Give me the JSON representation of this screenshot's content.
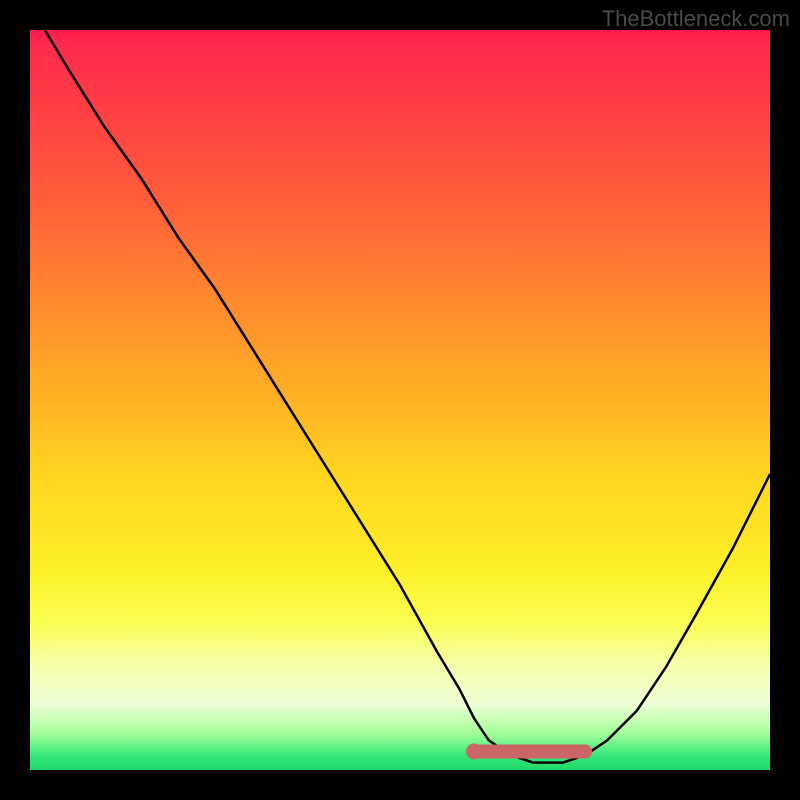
{
  "watermark": "TheBottleneck.com",
  "colors": {
    "background": "#000000",
    "curve": "#000000",
    "marker": "#cc6666",
    "gradient_top": "#ff1a4d",
    "gradient_bottom": "#20d86a"
  },
  "chart_data": {
    "type": "line",
    "title": "",
    "xlabel": "",
    "ylabel": "",
    "xlim": [
      0,
      100
    ],
    "ylim": [
      0,
      100
    ],
    "grid": false,
    "series": [
      {
        "name": "bottleneck-curve",
        "x": [
          2,
          5,
          10,
          15,
          20,
          25,
          30,
          35,
          40,
          45,
          50,
          55,
          58,
          60,
          62,
          65,
          68,
          72,
          75,
          78,
          82,
          86,
          90,
          95,
          100
        ],
        "y": [
          100,
          95,
          87,
          80,
          72,
          65,
          57,
          49,
          41,
          33,
          25,
          16,
          11,
          7,
          4,
          2,
          1,
          1,
          2,
          4,
          8,
          14,
          21,
          30,
          40
        ]
      }
    ],
    "highlight_segment": {
      "name": "optimal-range",
      "x_start": 60,
      "x_end": 75,
      "y_start": 2.5,
      "y_end": 2.5
    },
    "background_gradient_stops": [
      {
        "pos": 0.0,
        "color": "#ff1a4d"
      },
      {
        "pos": 0.22,
        "color": "#ff5a3a"
      },
      {
        "pos": 0.5,
        "color": "#ffb224"
      },
      {
        "pos": 0.73,
        "color": "#fdf028"
      },
      {
        "pos": 0.86,
        "color": "#f6ffac"
      },
      {
        "pos": 0.95,
        "color": "#a6ff9a"
      },
      {
        "pos": 1.0,
        "color": "#20d86a"
      }
    ]
  }
}
